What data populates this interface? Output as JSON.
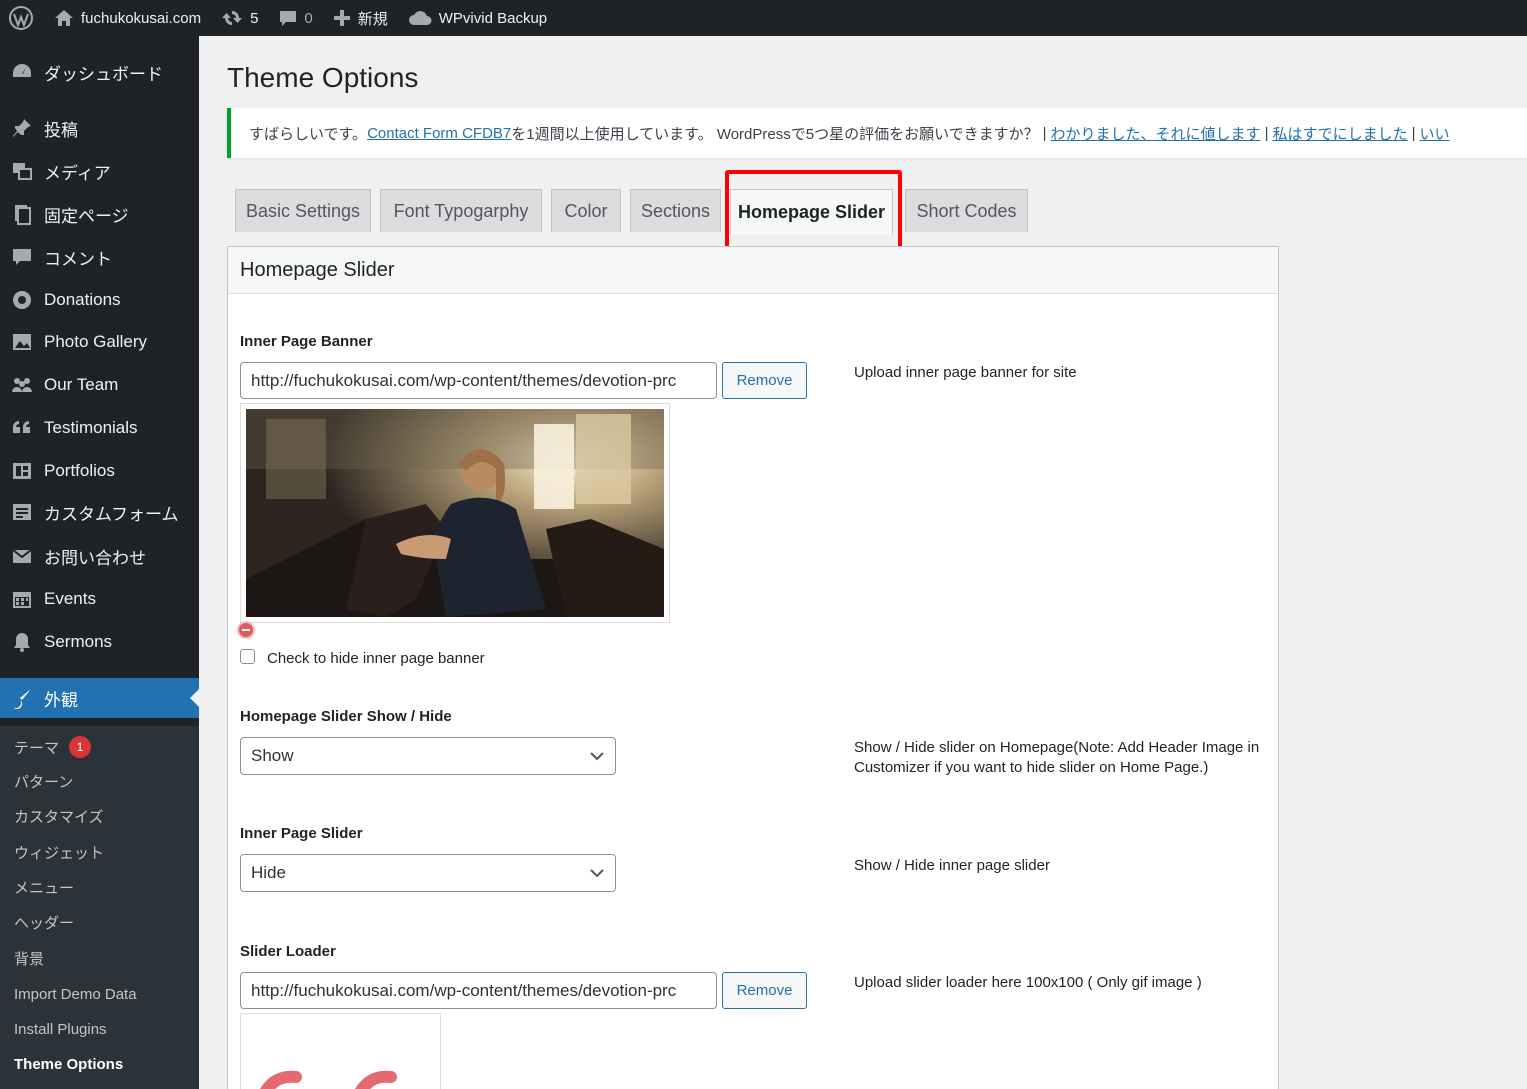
{
  "adminbar": {
    "wp_logo_icon": "wordpress-logo-icon",
    "site_name": "fuchukokusai.com",
    "updates_count": "5",
    "comments_count": "0",
    "new_label": "新規",
    "backup_label": "WPvivid Backup"
  },
  "sidebar": {
    "items": [
      {
        "label": "ダッシュボード",
        "icon": "dashboard-icon"
      },
      {
        "label": "投稿",
        "icon": "pin-icon"
      },
      {
        "label": "メディア",
        "icon": "media-icon"
      },
      {
        "label": "固定ページ",
        "icon": "pages-icon"
      },
      {
        "label": "コメント",
        "icon": "comment-icon"
      },
      {
        "label": "Donations",
        "icon": "donation-icon"
      },
      {
        "label": "Photo Gallery",
        "icon": "gallery-icon"
      },
      {
        "label": "Our Team",
        "icon": "team-icon"
      },
      {
        "label": "Testimonials",
        "icon": "quote-icon"
      },
      {
        "label": "Portfolios",
        "icon": "portfolio-icon"
      },
      {
        "label": "カスタムフォーム",
        "icon": "form-icon"
      },
      {
        "label": "お問い合わせ",
        "icon": "mail-icon"
      },
      {
        "label": "Events",
        "icon": "calendar-icon"
      },
      {
        "label": "Sermons",
        "icon": "bell-icon"
      },
      {
        "label": "外観",
        "icon": "brush-icon"
      }
    ],
    "submenu": [
      {
        "label": "テーマ",
        "badge": "1"
      },
      {
        "label": "パターン"
      },
      {
        "label": "カスタマイズ"
      },
      {
        "label": "ウィジェット"
      },
      {
        "label": "メニュー"
      },
      {
        "label": "ヘッダー"
      },
      {
        "label": "背景"
      },
      {
        "label": "Import Demo Data"
      },
      {
        "label": "Install Plugins"
      },
      {
        "label": "Theme Options"
      }
    ]
  },
  "page": {
    "title": "Theme Options",
    "notice": {
      "text_before": "すばらしいです。",
      "link_plugin": "Contact Form CFDB7",
      "text_middle": " を1週間以上使用しています。 WordPressで5つ星の評価をお願いできますか？",
      "link_ok": "わかりました、それに値します",
      "link_done": "私はすでにしました",
      "link_more": "いい",
      "separator": "|"
    },
    "tabs": [
      {
        "label": "Basic Settings"
      },
      {
        "label": "Font Typogarphy"
      },
      {
        "label": "Color"
      },
      {
        "label": "Sections"
      },
      {
        "label": "Homepage Slider"
      },
      {
        "label": "Short Codes"
      }
    ],
    "active_tab": "Homepage Slider",
    "highlight_color": "#ff0000"
  },
  "panel": {
    "title": "Homepage Slider",
    "inner_banner": {
      "label": "Inner Page Banner",
      "url": "http://fuchukokusai.com/wp-content/themes/devotion-prc",
      "remove_label": "Remove",
      "description": "Upload inner page banner for site",
      "hide_checkbox_label": "Check to hide inner page banner",
      "hide_checked": false
    },
    "slider_show": {
      "label": "Homepage Slider Show / Hide",
      "value": "Show",
      "description": "Show / Hide slider on Homepage(Note: Add Header Image in Customizer if you want to hide slider on Home Page.)"
    },
    "inner_slider": {
      "label": "Inner Page Slider",
      "value": "Hide",
      "description": "Show / Hide inner page slider"
    },
    "slider_loader": {
      "label": "Slider Loader",
      "url": "http://fuchukokusai.com/wp-content/themes/devotion-prc",
      "remove_label": "Remove",
      "description": "Upload slider loader here 100x100 ( Only gif image )"
    }
  },
  "colors": {
    "adminbar_bg": "#1d2327",
    "sidebar_bg": "#1d2327",
    "active_menu": "#2271b1",
    "notice_border": "#00a32a",
    "link": "#2271b1"
  }
}
